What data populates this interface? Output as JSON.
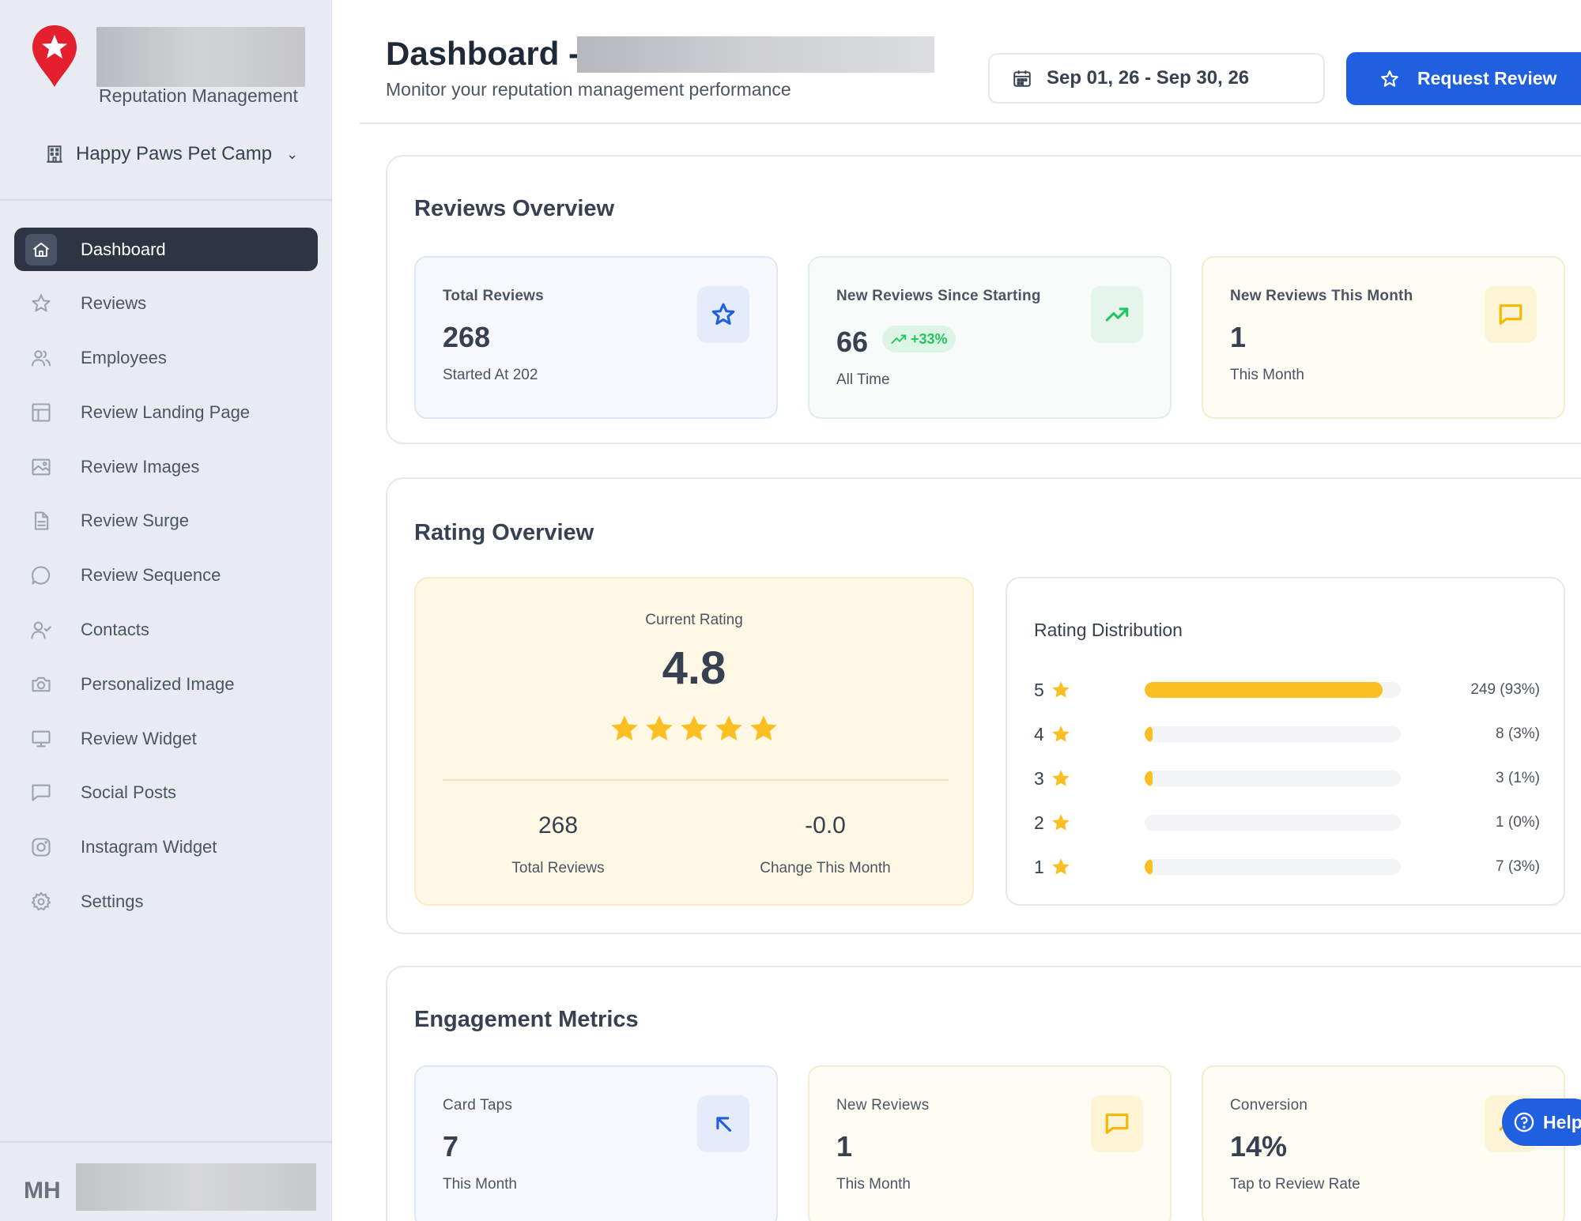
{
  "brand": {
    "subtitle": "Reputation Management"
  },
  "location": {
    "name": "Happy Paws Pet Camp"
  },
  "nav": {
    "items": [
      {
        "label": "Dashboard"
      },
      {
        "label": "Reviews"
      },
      {
        "label": "Employees"
      },
      {
        "label": "Review Landing Page"
      },
      {
        "label": "Review Images"
      },
      {
        "label": "Review Surge"
      },
      {
        "label": "Review Sequence"
      },
      {
        "label": "Contacts"
      },
      {
        "label": "Personalized Image"
      },
      {
        "label": "Review Widget"
      },
      {
        "label": "Social Posts"
      },
      {
        "label": "Instagram Widget"
      },
      {
        "label": "Settings"
      }
    ]
  },
  "user": {
    "initials": "MH"
  },
  "header": {
    "title": "Dashboard -",
    "subtitle": "Monitor your reputation management performance",
    "date_range": "Sep 01, 26 - Sep 30, 26",
    "request_review_label": "Request Review"
  },
  "reviews_overview": {
    "title": "Reviews Overview",
    "cards": [
      {
        "label": "Total Reviews",
        "value": "268",
        "note": "Started At 202"
      },
      {
        "label": "New Reviews Since Starting",
        "value": "66",
        "badge": "+33%",
        "note": "All Time"
      },
      {
        "label": "New Reviews This Month",
        "value": "1",
        "note": "This Month"
      }
    ]
  },
  "rating_overview": {
    "title": "Rating Overview",
    "current_label": "Current Rating",
    "current_value": "4.8",
    "stars": 5,
    "total_reviews_value": "268",
    "total_reviews_label": "Total Reviews",
    "change_value": "-0.0",
    "change_label": "Change This Month",
    "distribution_title": "Rating Distribution",
    "distribution": [
      {
        "stars": "5",
        "count": "249 (93%)",
        "percent": 93
      },
      {
        "stars": "4",
        "count": "8 (3%)",
        "percent": 3
      },
      {
        "stars": "3",
        "count": "3 (1%)",
        "percent": 1
      },
      {
        "stars": "2",
        "count": "1 (0%)",
        "percent": 0
      },
      {
        "stars": "1",
        "count": "7 (3%)",
        "percent": 3
      }
    ]
  },
  "engagement": {
    "title": "Engagement Metrics",
    "cards": [
      {
        "label": "Card Taps",
        "value": "7",
        "note": "This Month"
      },
      {
        "label": "New Reviews",
        "value": "1",
        "note": "This Month"
      },
      {
        "label": "Conversion",
        "value": "14%",
        "note": "Tap to Review Rate"
      }
    ]
  },
  "help": {
    "label": "Help"
  },
  "colors": {
    "accent": "#1f5fe0",
    "sidebar_active": "#2d3443",
    "star": "#fbbf24",
    "success": "#22c55e"
  }
}
